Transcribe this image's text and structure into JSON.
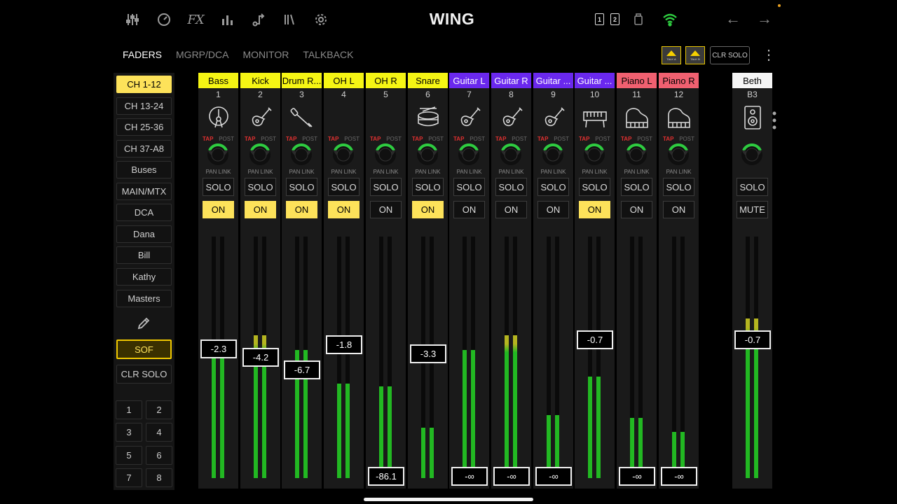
{
  "app": {
    "title": "WING",
    "top_icons": [
      "sliders-icon",
      "meter-icon",
      "fx-icon",
      "bars-icon",
      "routing-icon",
      "library-icon",
      "gear-icon"
    ],
    "fx_label": "FX",
    "card_labels": [
      "1",
      "2"
    ],
    "wifi_color": "#2ecc40",
    "back_arrow": "←",
    "forward_arrow": "→"
  },
  "tabs": [
    {
      "label": "FADERS",
      "active": true
    },
    {
      "label": "MGRP/DCA",
      "active": false
    },
    {
      "label": "MONITOR",
      "active": false
    },
    {
      "label": "TALKBACK",
      "active": false
    }
  ],
  "talk": {
    "a_label": "TALK A",
    "b_label": "TALK B"
  },
  "clr_solo_top": "CLR SOLO",
  "kebab": "⋮",
  "sidebar": {
    "layers": [
      "CH 1-12",
      "CH 13-24",
      "CH 25-36",
      "CH 37-A8",
      "Buses",
      "MAIN/MTX",
      "DCA",
      "Dana",
      "Bill",
      "Kathy",
      "Masters"
    ],
    "active_layer": 0,
    "sof": "SOF",
    "clr_solo": "CLR SOLO",
    "banks": [
      "1",
      "2",
      "3",
      "4",
      "5",
      "6",
      "7",
      "8"
    ]
  },
  "labels": {
    "tap": "TAP",
    "post": "POST",
    "pan_link": "PAN LINK",
    "solo": "SOLO",
    "on": "ON",
    "mute": "MUTE"
  },
  "channels": [
    {
      "name": "Bass",
      "number": "1",
      "color": "#f5f514",
      "text_color": "#000",
      "icon": "kick-drum-icon",
      "on": true,
      "fader": "-2.3",
      "fader_level": 0.71,
      "meter": 0.54,
      "hot": false
    },
    {
      "name": "Kick",
      "number": "2",
      "color": "#f5f514",
      "text_color": "#000",
      "icon": "guitar-icon",
      "on": true,
      "fader": "-4.2",
      "fader_level": 0.66,
      "meter": 0.59,
      "hot": true
    },
    {
      "name": "Drum R...",
      "number": "3",
      "color": "#f5f514",
      "text_color": "#000",
      "icon": "microphone-icon",
      "on": true,
      "fader": "-6.7",
      "fader_level": 0.59,
      "meter": 0.53,
      "hot": false
    },
    {
      "name": "OH L",
      "number": "4",
      "color": "#f5f514",
      "text_color": "#000",
      "icon": "none",
      "on": true,
      "fader": "-1.8",
      "fader_level": 0.73,
      "meter": 0.39,
      "hot": false
    },
    {
      "name": "OH R",
      "number": "5",
      "color": "#f5f514",
      "text_color": "#000",
      "icon": "none",
      "on": false,
      "fader": "-86.1",
      "fader_level": 0.0,
      "meter": 0.38,
      "hot": false
    },
    {
      "name": "Snare",
      "number": "6",
      "color": "#f5f514",
      "text_color": "#000",
      "icon": "snare-drum-icon",
      "on": true,
      "fader": "-3.3",
      "fader_level": 0.68,
      "meter": 0.21,
      "hot": false
    },
    {
      "name": "Guitar L",
      "number": "7",
      "color": "#6a28ee",
      "text_color": "#fff",
      "icon": "guitar-icon",
      "on": false,
      "fader": "-∞",
      "fader_level": 0.0,
      "meter": 0.53,
      "hot": false
    },
    {
      "name": "Guitar R",
      "number": "8",
      "color": "#6a28ee",
      "text_color": "#fff",
      "icon": "guitar-icon",
      "on": false,
      "fader": "-∞",
      "fader_level": 0.0,
      "meter": 0.59,
      "hot": true
    },
    {
      "name": "Guitar ...",
      "number": "9",
      "color": "#6a28ee",
      "text_color": "#fff",
      "icon": "guitar-icon",
      "on": false,
      "fader": "-∞",
      "fader_level": 0.0,
      "meter": 0.26,
      "hot": false
    },
    {
      "name": "Guitar ...",
      "number": "10",
      "color": "#6a28ee",
      "text_color": "#fff",
      "icon": "keyboard-icon",
      "on": true,
      "fader": "-0.7",
      "fader_level": 0.76,
      "meter": 0.42,
      "hot": false
    },
    {
      "name": "Piano L",
      "number": "11",
      "color": "#f06070",
      "text_color": "#000",
      "icon": "piano-icon",
      "on": false,
      "fader": "-∞",
      "fader_level": 0.0,
      "meter": 0.25,
      "hot": false
    },
    {
      "name": "Piano R",
      "number": "12",
      "color": "#f06070",
      "text_color": "#000",
      "icon": "piano-icon",
      "on": false,
      "fader": "-∞",
      "fader_level": 0.0,
      "meter": 0.19,
      "hot": false
    }
  ],
  "master": {
    "name": "Beth",
    "number": "B3",
    "color": "#f5f5f5",
    "text_color": "#000",
    "icon": "speaker-icon",
    "fader": "-0.7",
    "fader_level": 0.76,
    "meter": 0.66,
    "hot": true
  },
  "meter_colors": {
    "green": "#22b822",
    "yellow": "#b5b520"
  }
}
